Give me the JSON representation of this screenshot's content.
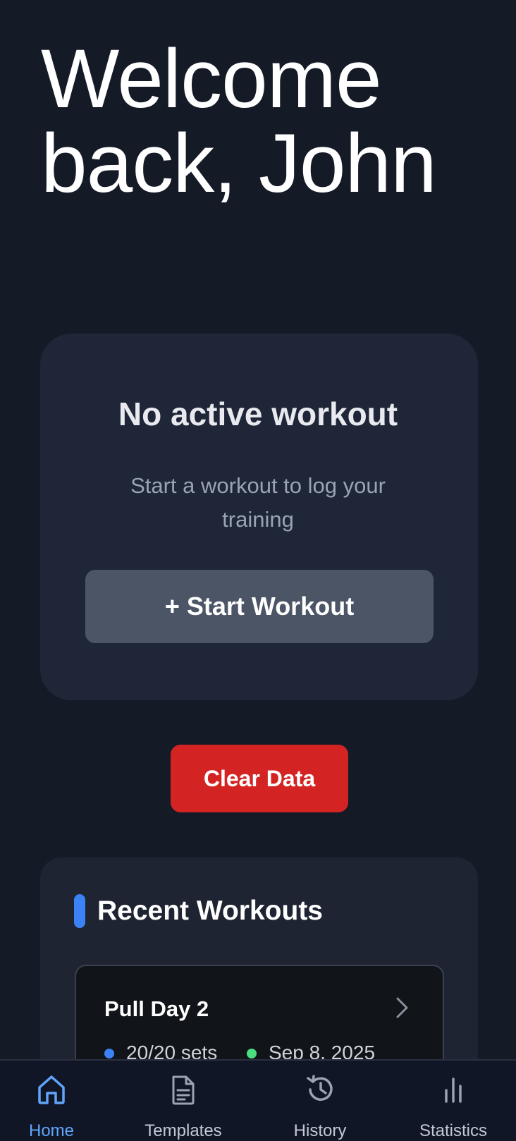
{
  "header": {
    "welcome_line1": "Welcome",
    "welcome_line2": "back, John"
  },
  "active_workout": {
    "title": "No active workout",
    "subtitle": "Start a workout to log your training",
    "start_button": "+ Start Workout"
  },
  "actions": {
    "clear_data": "Clear Data"
  },
  "recent": {
    "title": "Recent Workouts",
    "items": [
      {
        "name": "Pull Day 2",
        "sets": "20/20 sets",
        "date": "Sep 8, 2025"
      }
    ]
  },
  "nav": {
    "items": [
      {
        "label": "Home",
        "icon": "home-icon",
        "active": true
      },
      {
        "label": "Templates",
        "icon": "document-icon",
        "active": false
      },
      {
        "label": "History",
        "icon": "history-icon",
        "active": false
      },
      {
        "label": "Statistics",
        "icon": "bar-chart-icon",
        "active": false
      }
    ]
  },
  "colors": {
    "background": "#151a27",
    "card": "#1f2638",
    "primary": "#3b82f6",
    "danger": "#d32322",
    "success": "#4ade80",
    "nav_active": "#60a5fa"
  }
}
